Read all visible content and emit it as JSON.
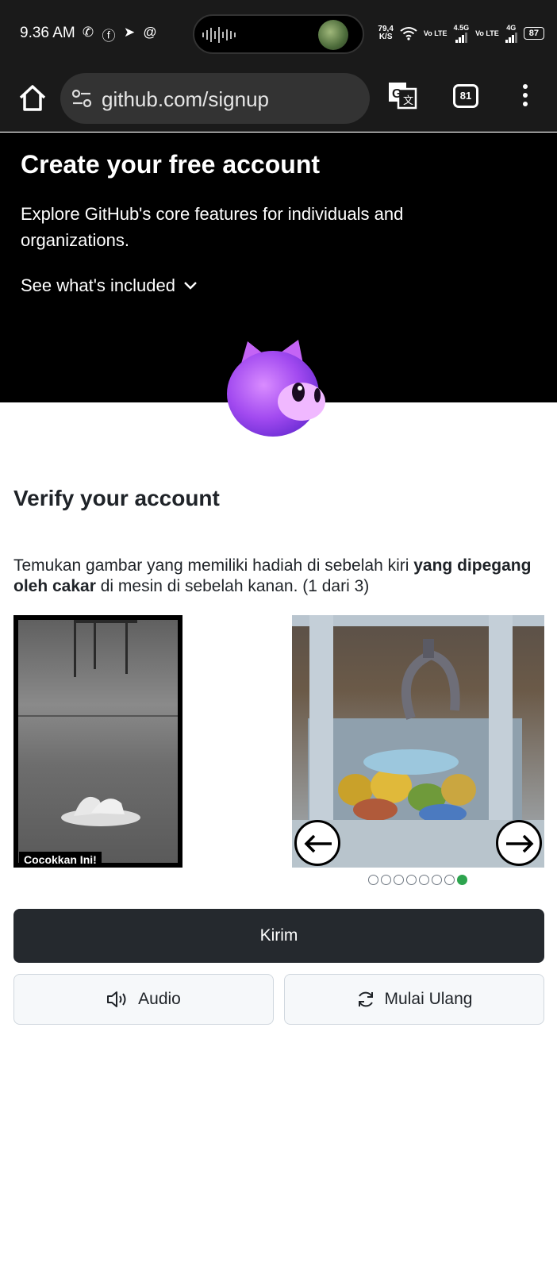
{
  "status_bar": {
    "time": "9.36 AM",
    "net_speed_value": "79,4",
    "net_speed_unit": "K/S",
    "sim1_label": "Vo LTE",
    "sim1_network": "4.5G",
    "sim2_label": "Vo LTE",
    "sim2_network": "4G",
    "battery": "87"
  },
  "browser": {
    "url": "github.com/signup",
    "tab_count": "81"
  },
  "hero": {
    "title": "Create your free account",
    "description": "Explore GitHub's core features for individuals and organizations.",
    "see_included": "See what's included"
  },
  "verify": {
    "title": "Verify your account",
    "instruction_part1": "Temukan gambar yang memiliki hadiah di sebelah kiri ",
    "instruction_bold": "yang dipegang oleh cakar",
    "instruction_part2": " di mesin di sebelah kanan. (1 dari 3)",
    "match_label": "Cocokkan Ini!",
    "dots_total": 8,
    "dots_active_index": 7
  },
  "buttons": {
    "submit": "Kirim",
    "audio": "Audio",
    "restart": "Mulai Ulang"
  },
  "colors": {
    "hero_bg": "#000000",
    "submit_bg": "#25292e",
    "active_dot": "#2da44e",
    "mascot": "#b04df0"
  }
}
